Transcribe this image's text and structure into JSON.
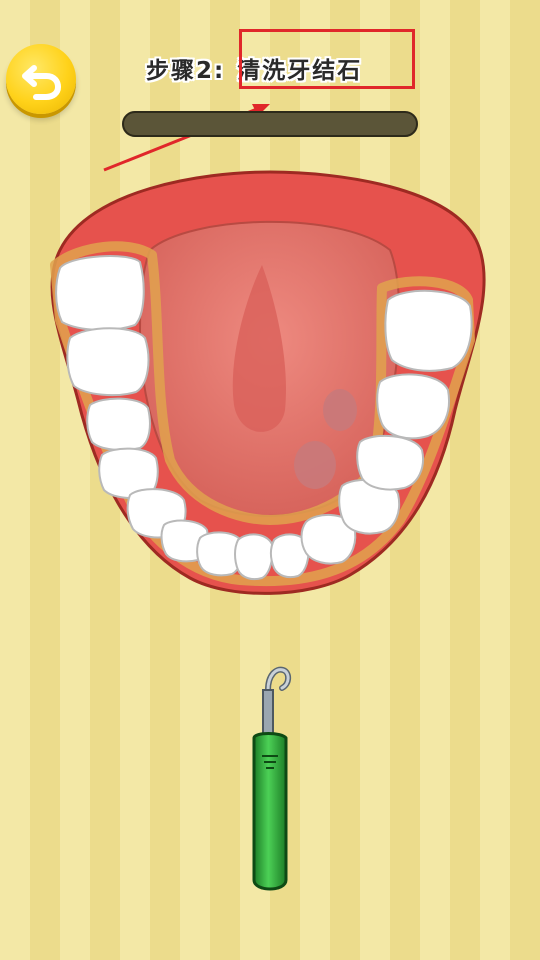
{
  "header": {
    "step_label": "步骤2:",
    "step_action": "清洗牙结石"
  },
  "progress": {
    "value": 0
  },
  "icons": {
    "back": "undo-arrow-icon",
    "tool": "dental-scaler-icon"
  },
  "colors": {
    "highlight": "#e0272a",
    "back_button": "#ffd21a",
    "gum": "#e6524d",
    "tongue": "#e97b73",
    "tartar": "#e0a24e",
    "tool_handle": "#2fae3c"
  }
}
